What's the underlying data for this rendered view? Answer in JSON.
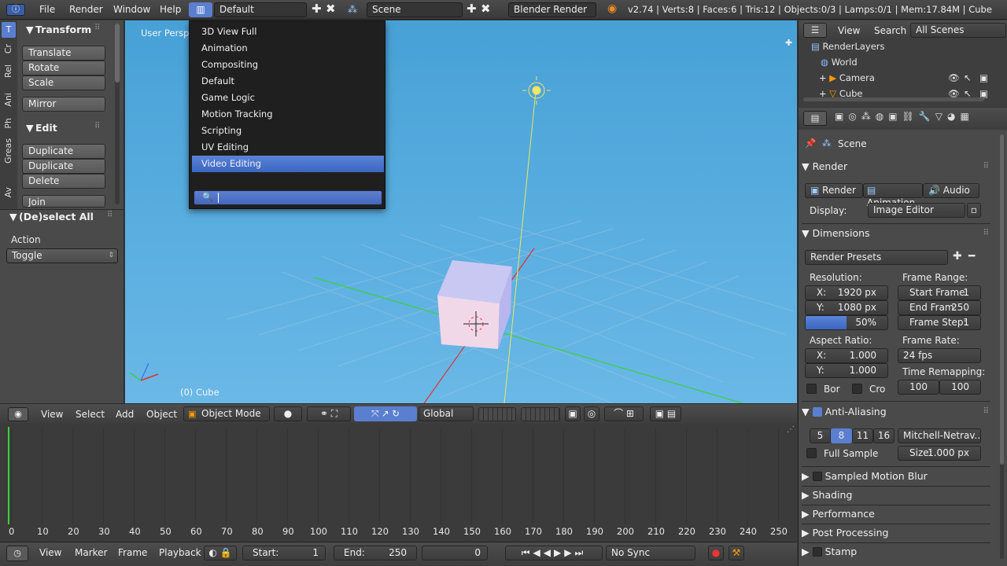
{
  "topbar": {
    "menus": [
      "File",
      "Render",
      "Window",
      "Help"
    ],
    "layout": "Default",
    "scene": "Scene",
    "engine": "Blender Render",
    "stats": "v2.74 | Verts:8 | Faces:6 | Tris:12 | Objects:0/3 | Lamps:0/1 | Mem:17.84M | Cube"
  },
  "toolshelf": {
    "tabs": [
      "T",
      "Cr",
      "Rel",
      "Ani",
      "Ph",
      "Greas",
      "Av"
    ],
    "transform_title": "Transform",
    "transform_buttons": [
      "Translate",
      "Rotate",
      "Scale",
      "Mirror"
    ],
    "edit_title": "Edit",
    "edit_buttons": [
      "Duplicate",
      "Duplicate Linked",
      "Delete",
      "Join"
    ],
    "operator_title": "(De)select All",
    "action_label": "Action",
    "action_value": "Toggle"
  },
  "viewport": {
    "view_label": "User Persp",
    "object_label": "(0) Cube"
  },
  "dropdown": {
    "items": [
      "3D View Full",
      "Animation",
      "Compositing",
      "Default",
      "Game Logic",
      "Motion Tracking",
      "Scripting",
      "UV Editing",
      "Video Editing"
    ],
    "selected": "Video Editing"
  },
  "viewhdr": {
    "menus": [
      "View",
      "Select",
      "Add",
      "Object"
    ],
    "mode": "Object Mode",
    "orientation": "Global"
  },
  "timeline": {
    "ticks": [
      "0",
      "10",
      "20",
      "30",
      "40",
      "50",
      "60",
      "70",
      "80",
      "90",
      "100",
      "110",
      "120",
      "130",
      "140",
      "150",
      "160",
      "170",
      "180",
      "190",
      "200",
      "210",
      "220",
      "230",
      "240",
      "250"
    ]
  },
  "tlhdr": {
    "menus": [
      "View",
      "Marker",
      "Frame",
      "Playback"
    ],
    "start_label": "Start:",
    "start": "1",
    "end_label": "End:",
    "end": "250",
    "current": "0",
    "sync": "No Sync"
  },
  "outliner": {
    "menus": [
      "View",
      "Search"
    ],
    "filter": "All Scenes",
    "items": [
      "RenderLayers",
      "World",
      "Camera",
      "Cube"
    ]
  },
  "props": {
    "breadcrumb": "Scene",
    "render_title": "Render",
    "render_buttons": [
      "Render",
      "Animation",
      "Audio"
    ],
    "display_label": "Display:",
    "display_value": "Image Editor",
    "dimensions_title": "Dimensions",
    "presets": "Render Presets",
    "resolution_label": "Resolution:",
    "res_x_label": "X:",
    "res_x": "1920 px",
    "res_y_label": "Y:",
    "res_y": "1080 px",
    "res_pct": "50%",
    "res_pct_fill": 0.5,
    "frame_range_label": "Frame Range:",
    "start_frame": "Start Frame:",
    "start_frame_val": "1",
    "end_frame": "End Fram:",
    "end_frame_val": "250",
    "frame_step": "Frame Step:",
    "frame_step_val": "1",
    "aspect_label": "Aspect Ratio:",
    "asp_x_label": "X:",
    "asp_x": "1.000",
    "asp_y_label": "Y:",
    "asp_y": "1.000",
    "frame_rate_label": "Frame Rate:",
    "frame_rate": "24 fps",
    "time_remap_label": "Time Remapping:",
    "remap_old": "100",
    "remap_new": "100",
    "bor": "Bor",
    "cro": "Cro",
    "aa_title": "Anti-Aliasing",
    "aa_samples": [
      "5",
      "8",
      "11",
      "16"
    ],
    "aa_selected": "8",
    "filter": "Mitchell-Netrav...",
    "full_sample": "Full Sample",
    "size_label": "Size:",
    "size_val": "1.000 px",
    "collapsed": [
      "Sampled Motion Blur",
      "Shading",
      "Performance",
      "Post Processing",
      "Stamp"
    ]
  }
}
